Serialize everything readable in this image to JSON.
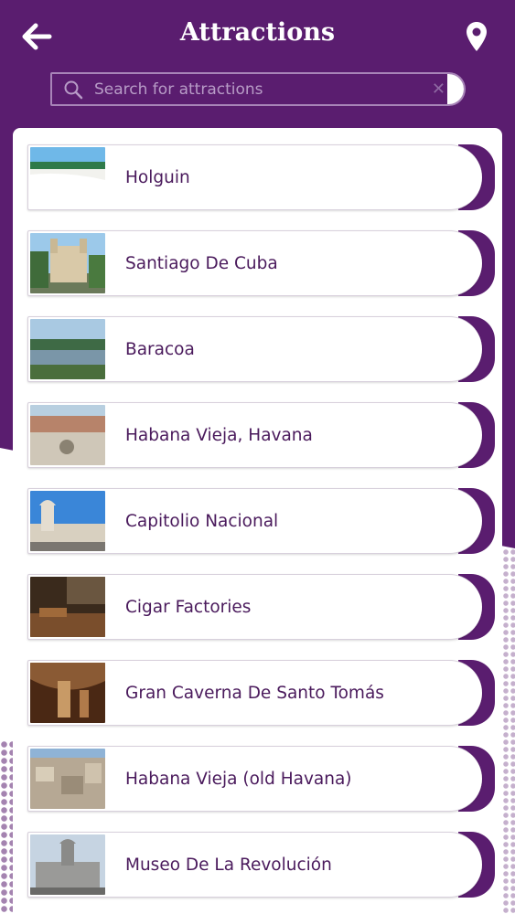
{
  "header": {
    "title": "Attractions",
    "back_icon": "arrow-left-icon",
    "location_icon": "map-pin-icon"
  },
  "search": {
    "placeholder": "Search for attractions",
    "value": "",
    "clear_icon": "close-icon"
  },
  "colors": {
    "primary": "#5a1d6f",
    "text": "#4a1a5c",
    "background": "#ffffff"
  },
  "attractions": [
    {
      "name": "Holguin"
    },
    {
      "name": "Santiago De Cuba"
    },
    {
      "name": "Baracoa"
    },
    {
      "name": "Habana Vieja, Havana"
    },
    {
      "name": "Capitolio Nacional"
    },
    {
      "name": "Cigar Factories"
    },
    {
      "name": "Gran Caverna De Santo Tomás"
    },
    {
      "name": "Habana Vieja (old Havana)"
    },
    {
      "name": "Museo De La Revolución"
    }
  ]
}
